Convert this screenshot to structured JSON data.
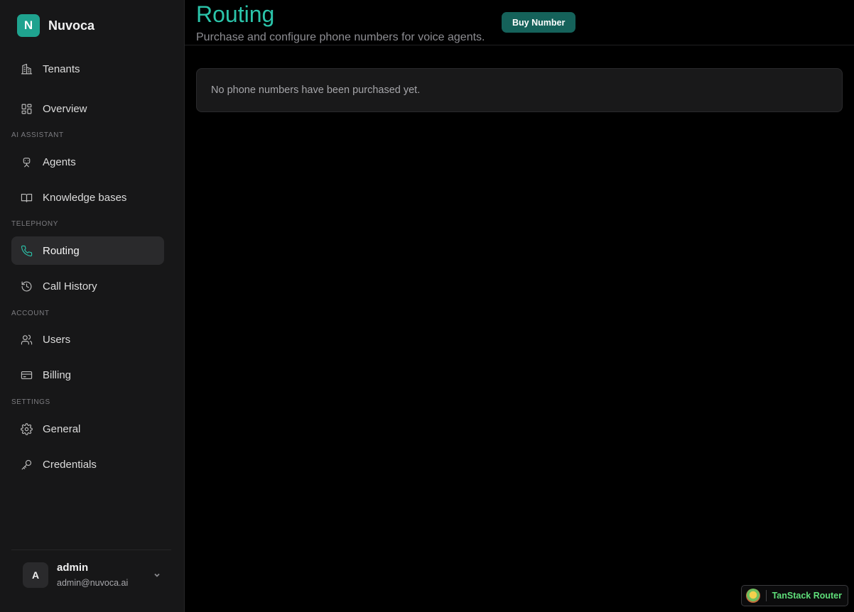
{
  "brand": {
    "logo_letter": "N",
    "name": "Nuvoca",
    "accent": "#1fa38f"
  },
  "nav": {
    "tenants": "Tenants",
    "overview": "Overview",
    "section_ai": "AI ASSISTANT",
    "agents": "Agents",
    "knowledge_bases": "Knowledge bases",
    "section_telephony": "TELEPHONY",
    "routing": "Routing",
    "call_history": "Call History",
    "section_account": "ACCOUNT",
    "users": "Users",
    "billing": "Billing",
    "section_settings": "SETTINGS",
    "general": "General",
    "credentials": "Credentials"
  },
  "user": {
    "avatar_letter": "A",
    "name": "admin",
    "email": "admin@nuvoca.ai"
  },
  "page": {
    "title": "Routing",
    "subtitle": "Purchase and configure phone numbers for voice agents.",
    "buy_button": "Buy Number",
    "empty_message": "No phone numbers have been purchased yet."
  },
  "devtools": {
    "label": "TanStack Router"
  },
  "icons": {
    "tenants": "building-icon",
    "overview": "dashboard-icon",
    "agents": "robot-icon",
    "knowledge_bases": "book-icon",
    "routing": "phone-icon",
    "call_history": "history-icon",
    "users": "users-icon",
    "billing": "credit-card-icon",
    "general": "gear-icon",
    "credentials": "key-icon"
  }
}
